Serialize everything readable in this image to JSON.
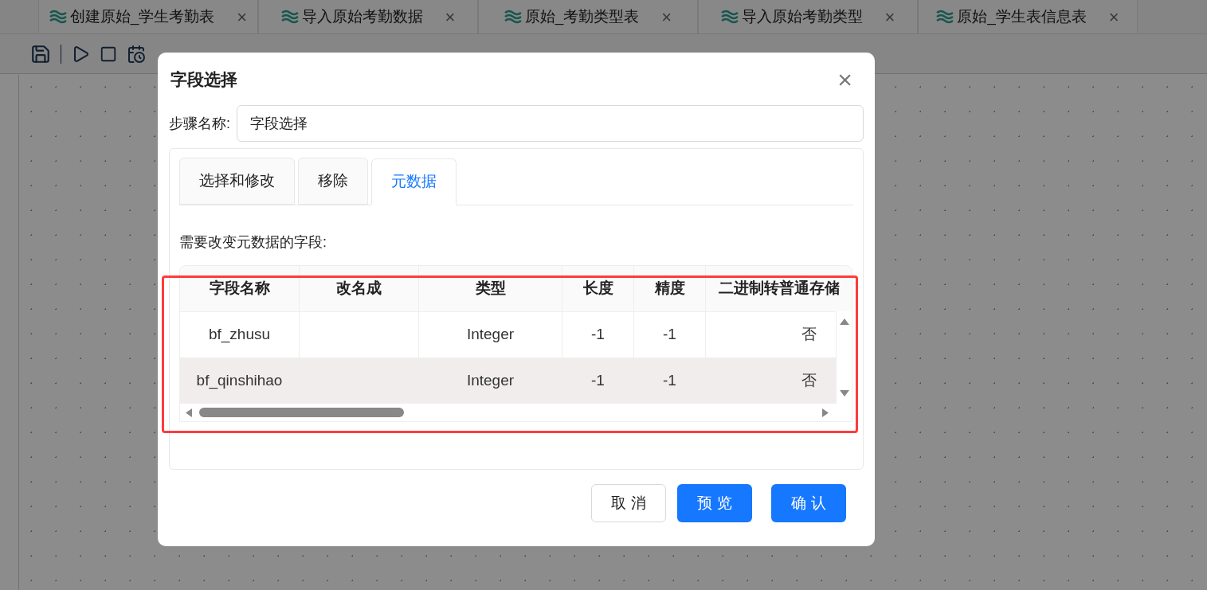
{
  "doc_tabs": [
    {
      "label": "创建原始_学生考勤表",
      "close": "×"
    },
    {
      "label": "导入原始考勤数据",
      "close": "×"
    },
    {
      "label": "原始_考勤类型表",
      "close": "×"
    },
    {
      "label": "导入原始考勤类型",
      "close": "×"
    },
    {
      "label": "原始_学生表信息表",
      "close": "×"
    }
  ],
  "dialog": {
    "title": "字段选择",
    "close": "×",
    "step_name": {
      "label": "步骤名称:",
      "value": "字段选择"
    },
    "tabs": [
      {
        "label": "选择和修改",
        "selected": false
      },
      {
        "label": "移除",
        "selected": false
      },
      {
        "label": "元数据",
        "selected": true
      }
    ],
    "section_label": "需要改变元数据的字段:",
    "table": {
      "columns": [
        "字段名称",
        "改名成",
        "类型",
        "长度",
        "精度",
        "二进制转普通存储"
      ],
      "rows": [
        {
          "cells": [
            "bf_zhusu",
            "",
            "Integer",
            "-1",
            "-1",
            "否"
          ],
          "selected": false
        },
        {
          "cells": [
            "bf_qinshihao",
            "",
            "Integer",
            "-1",
            "-1",
            "否"
          ],
          "selected": true
        }
      ]
    },
    "buttons": [
      {
        "label": "取 消",
        "kind": "default"
      },
      {
        "label": "预 览",
        "kind": "primary"
      },
      {
        "label": "确 认",
        "kind": "primary"
      }
    ]
  }
}
